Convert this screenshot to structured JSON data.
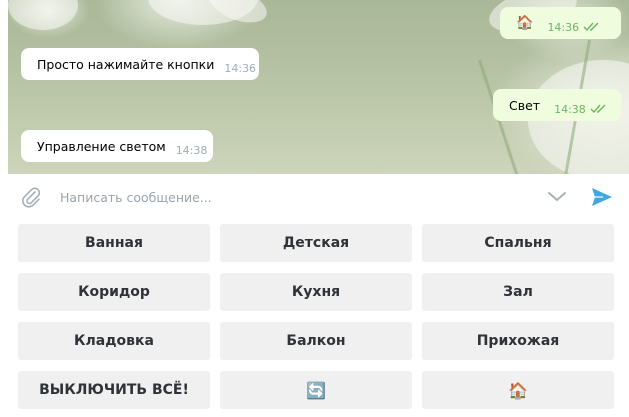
{
  "chat": {
    "messages": [
      {
        "direction": "out",
        "text": "🏠",
        "time": "14:36",
        "read": true
      },
      {
        "direction": "in",
        "text": "Просто нажимайте кнопки",
        "time": "14:36"
      },
      {
        "direction": "out",
        "text": "Свет",
        "time": "14:38",
        "read": true
      },
      {
        "direction": "in",
        "text": "Управление светом",
        "time": "14:38"
      }
    ]
  },
  "composer": {
    "placeholder": "Написать сообщение..."
  },
  "keyboard": {
    "rows": [
      [
        "Ванная",
        "Детская",
        "Спальня"
      ],
      [
        "Коридор",
        "Кухня",
        "Зал"
      ],
      [
        "Кладовка",
        "Балкон",
        "Прихожая"
      ],
      [
        "ВЫКЛЮЧИТЬ ВСЁ!",
        "🔄",
        "🏠"
      ]
    ]
  },
  "colors": {
    "send_icon": "#40a7e3",
    "read_ticks": "#6cb465",
    "out_bubble": "#effdde",
    "button_bg": "#f0f0f0"
  },
  "icons": {
    "attach": "paperclip-icon",
    "keyboard_toggle": "chevron-down-icon",
    "send": "send-icon",
    "read_receipt": "double-check-icon"
  }
}
